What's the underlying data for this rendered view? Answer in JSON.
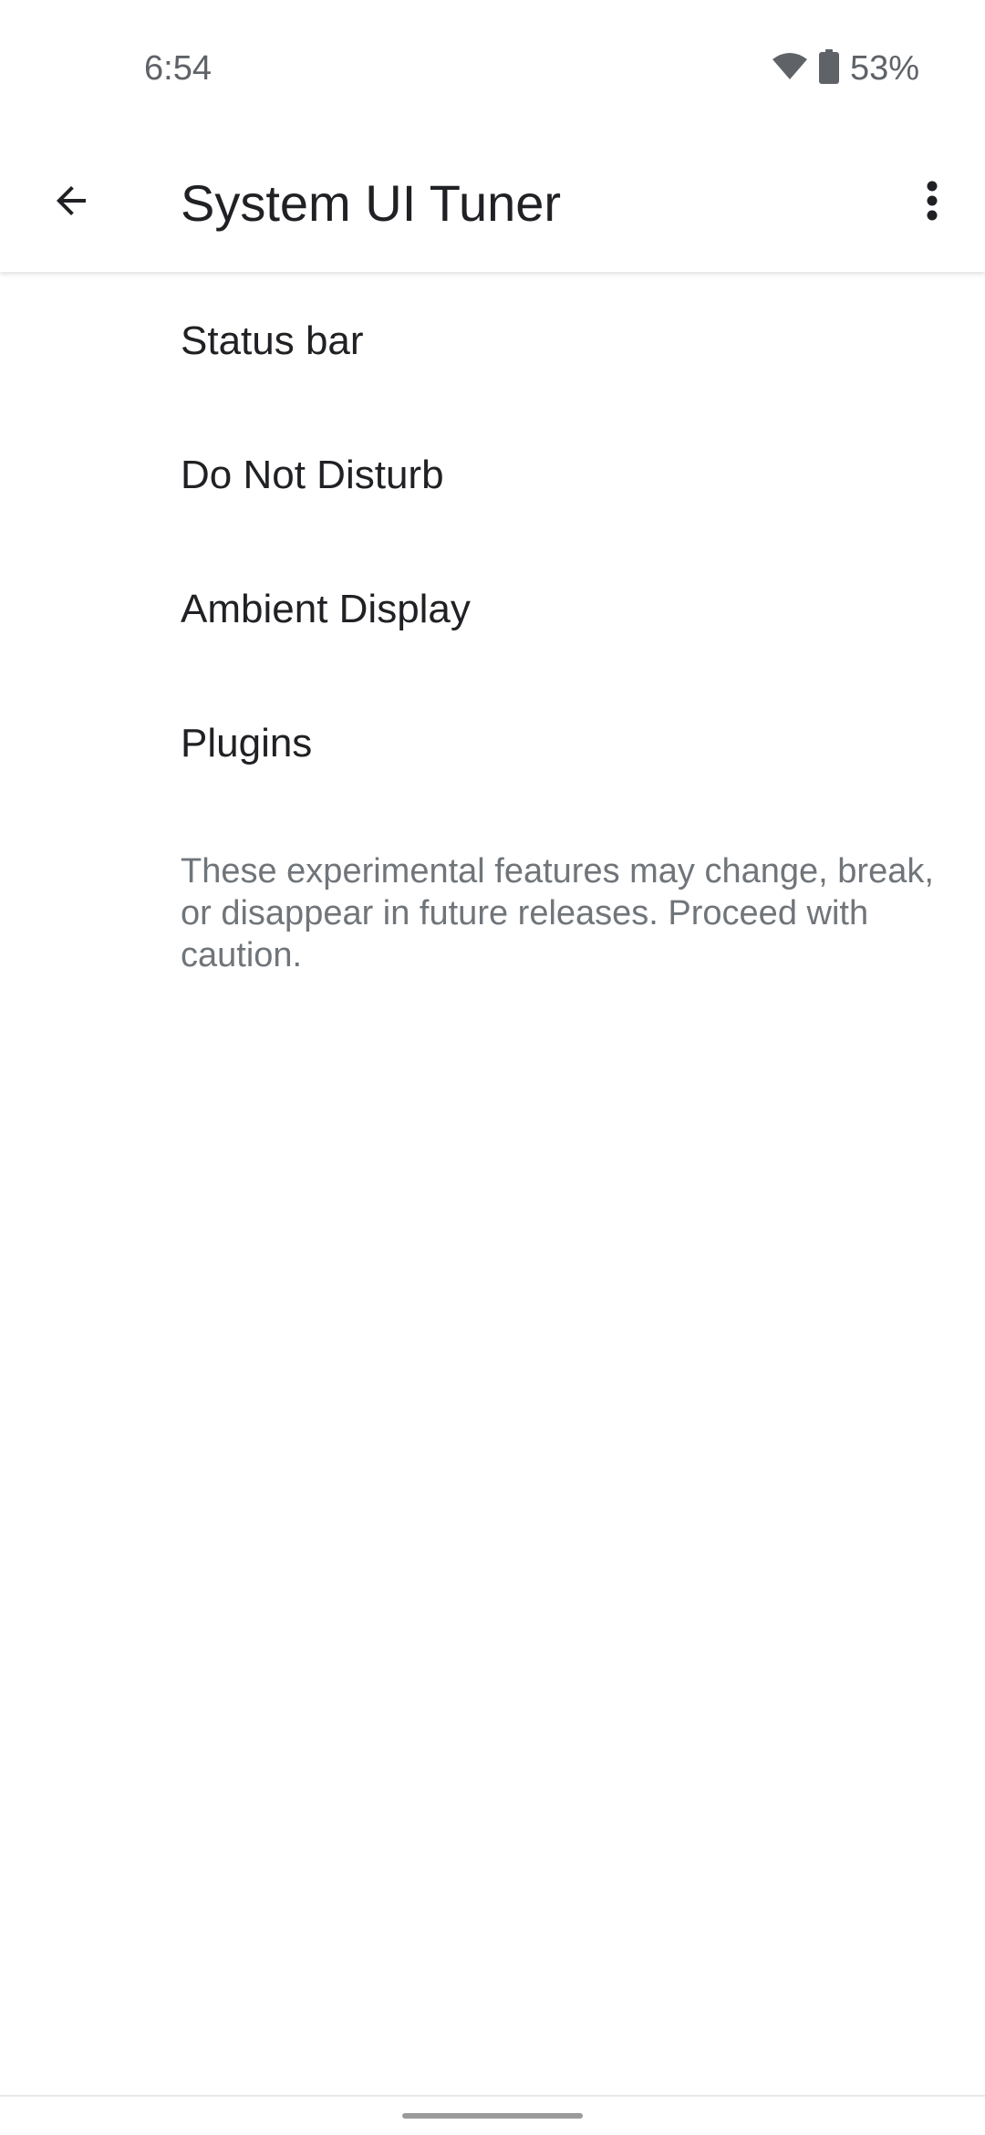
{
  "status_bar": {
    "time": "6:54",
    "battery_percent": "53%",
    "icons": [
      "wifi-icon",
      "battery-icon"
    ]
  },
  "app_bar": {
    "title": "System UI Tuner",
    "back_icon": "arrow-back-icon",
    "overflow_icon": "more-vert-icon"
  },
  "menu": {
    "items": [
      {
        "label": "Status bar"
      },
      {
        "label": "Do Not Disturb"
      },
      {
        "label": "Ambient Display"
      },
      {
        "label": "Plugins"
      }
    ]
  },
  "footer_note": "These experimental features may change, break, or disappear in future releases. Proceed with caution.",
  "colors": {
    "background": "#ffffff",
    "primary_text": "#202124",
    "secondary_text": "#70757a",
    "status_text": "#5f6368"
  }
}
